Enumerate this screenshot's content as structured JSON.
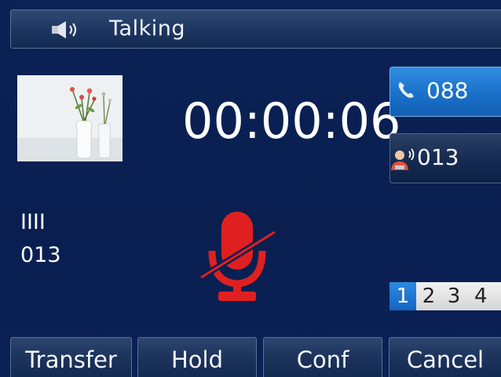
{
  "status": {
    "title": "Talking",
    "icon": "speaker-icon"
  },
  "call": {
    "timer": "00:00:06",
    "caller_name": "IIII",
    "caller_number": "013",
    "mute_icon": "microphone-muted-icon",
    "mute_color": "#e02020"
  },
  "line_keys": [
    {
      "label": "088",
      "icon": "phone-icon",
      "active": true
    },
    {
      "label": "013",
      "icon": "contact-talking-icon",
      "active": false
    }
  ],
  "pages": {
    "items": [
      "1",
      "2",
      "3",
      "4"
    ],
    "active": "1"
  },
  "softkeys": [
    "Transfer",
    "Hold",
    "Conf",
    "Cancel"
  ],
  "colors": {
    "background": "#0a1f52",
    "active_blue": "#1a70c8",
    "mute_red": "#e02020"
  }
}
